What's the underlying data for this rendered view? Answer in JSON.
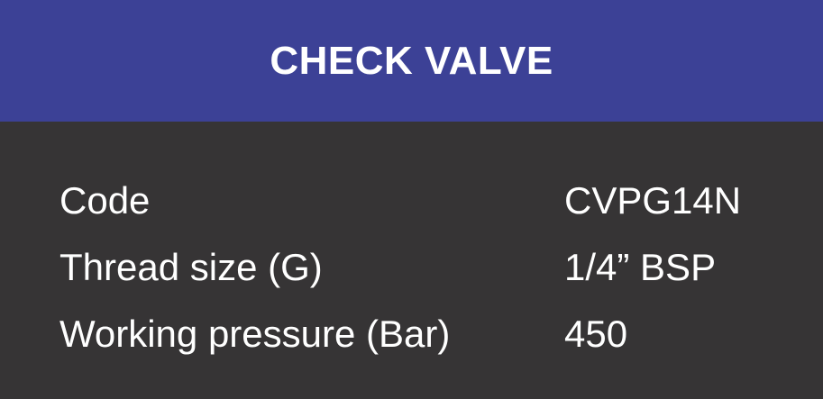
{
  "header": {
    "title": "CHECK VALVE"
  },
  "specs": [
    {
      "label": "Code",
      "value": "CVPG14N"
    },
    {
      "label": "Thread size (G)",
      "value": "1/4” BSP"
    },
    {
      "label": "Working pressure (Bar)",
      "value": "450"
    }
  ],
  "colors": {
    "header_bg": "#3c4196",
    "body_bg": "#363435",
    "text": "#ffffff"
  }
}
